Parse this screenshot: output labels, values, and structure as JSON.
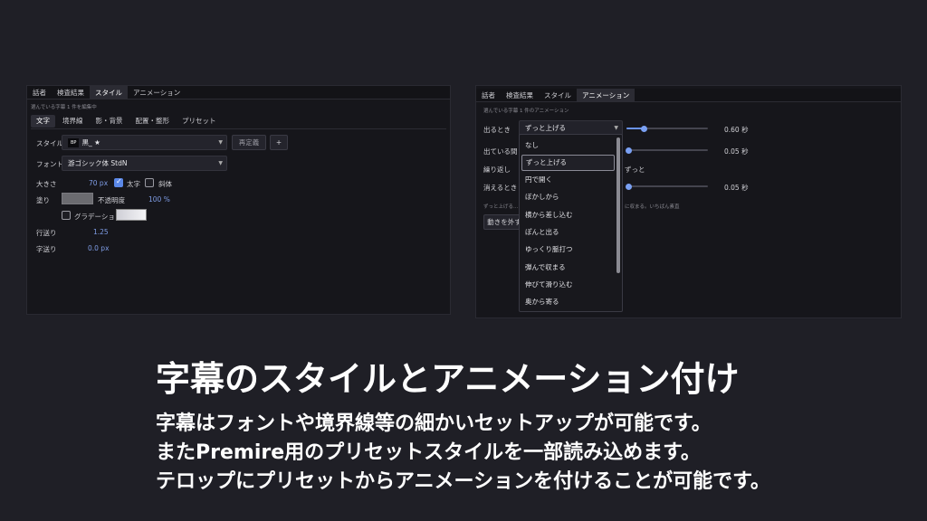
{
  "left_panel": {
    "tabs": [
      "話者",
      "検査結果",
      "スタイル",
      "アニメーション"
    ],
    "active_tab_index": 2,
    "note": "選んでいる字幕 1 件を編集中",
    "subtabs": [
      "文字",
      "境界線",
      "影・背景",
      "配置・整形",
      "プリセット"
    ],
    "active_subtab_index": 0,
    "style_label": "スタイル",
    "style_badge": "BP",
    "style_value": "黒_ ★",
    "redefine_button": "再定義",
    "add_button": "+",
    "font_label": "フォント",
    "font_value": "游ゴシック体 StdN",
    "size_label": "大きさ",
    "size_value": "70 px",
    "bold_label": "太字",
    "italic_label": "斜体",
    "fill_label": "塗り",
    "opacity_label": "不透明度",
    "opacity_value": "100 %",
    "gradation_label": "グラデーション",
    "line_spacing_label": "行送り",
    "line_spacing_value": "1.25",
    "char_spacing_label": "字送り",
    "char_spacing_value": "0.0 px",
    "bold_checked": true,
    "italic_checked": false,
    "gradation_checked": false,
    "colors": {
      "fill_swatch": "#6b6b70",
      "accent": "#6a93ee"
    }
  },
  "right_panel": {
    "tabs": [
      "話者",
      "検査結果",
      "スタイル",
      "アニメーション"
    ],
    "active_tab_index": 3,
    "note": "選んでいる字幕 1 件のアニメーション",
    "enter_label": "出るとき",
    "enter_value": "ずっと上げる",
    "enter_time": "0.60 秒",
    "stay_label": "出ている間",
    "stay_time": "0.05 秒",
    "repeat_label": "繰り返し",
    "repeat_value_tail": "ずっと",
    "exit_label": "消えるとき",
    "exit_time": "0.05 秒",
    "hint_left": "ずっと上げる...",
    "hint_right": "に収まる。いちばん素直",
    "remove_button": "動きを外す",
    "slider_levels": {
      "enter": 0.2,
      "stay": 0.0,
      "exit": 0.0
    },
    "dropdown_items": [
      "なし",
      "ずっと上げる",
      "円で開く",
      "ぼかしから",
      "横から差し込む",
      "ぽんと出る",
      "ゆっくり脈打つ",
      "弾んで収まる",
      "伸びて滑り込む",
      "奥から寄る"
    ],
    "dropdown_selected_index": 1
  },
  "caption": {
    "title": "字幕のスタイルとアニメーション付け",
    "lines": [
      "字幕はフォントや境界線等の細かいセットアップが可能です。",
      "またPremire用のプリセットスタイルを一部読み込めます。",
      "テロップにプリセットからアニメーションを付けることが可能です。"
    ]
  }
}
